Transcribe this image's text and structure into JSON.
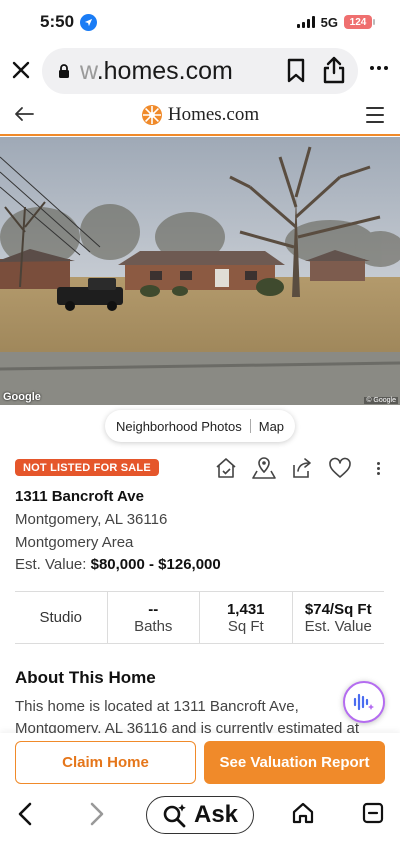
{
  "status_bar": {
    "time": "5:50",
    "network": "5G",
    "battery": "124"
  },
  "browser": {
    "url_faded": "w",
    "url_main": ".homes.com"
  },
  "site": {
    "logo_text": "Homes.com"
  },
  "photo": {
    "google_attribution": "Google",
    "copyright": "© Google"
  },
  "photo_toggle": {
    "neighborhood": "Neighborhood Photos",
    "map": "Map"
  },
  "listing": {
    "status_badge": "NOT LISTED FOR SALE",
    "address": "1311 Bancroft Ave",
    "city_state_zip": "Montgomery, AL 36116",
    "area": "Montgomery Area",
    "est_label": "Est. Value:",
    "est_value": "$80,000 - $126,000"
  },
  "stats": {
    "beds": "Studio",
    "baths_value": "--",
    "baths_label": "Baths",
    "sqft_value": "1,431",
    "sqft_label": "Sq Ft",
    "price_sqft_value": "$74/Sq Ft",
    "price_sqft_label": "Est. Value"
  },
  "about": {
    "title": "About This Home",
    "body": "This home is located at 1311 Bancroft Ave, Montgomery, AL 36116 and is currently estimated at"
  },
  "cta": {
    "claim": "Claim Home",
    "valuation": "See Valuation Report"
  },
  "bottom_nav": {
    "ask": "Ask"
  },
  "colors": {
    "brand_orange": "#f08a2a",
    "badge_red": "#e5562b"
  }
}
